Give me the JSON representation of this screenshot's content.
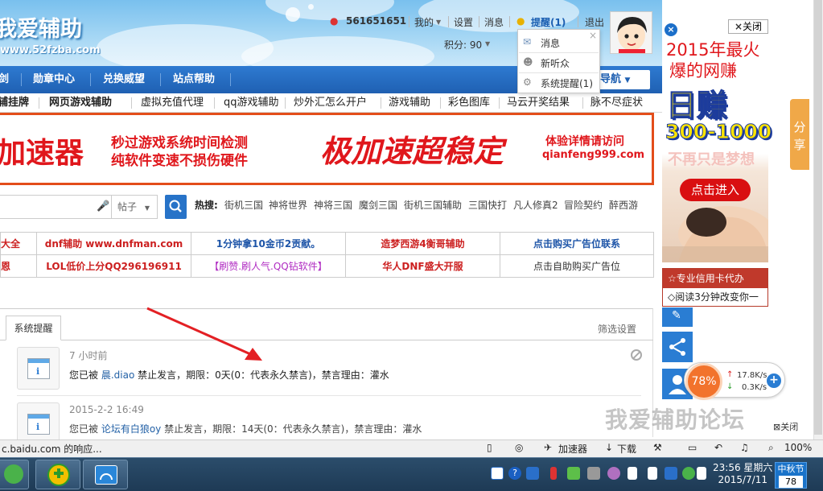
{
  "header": {
    "logo_text": "我爱辅助",
    "logo_url": "www.52fzba.com",
    "qq_number": "561651651",
    "my_label": "我的",
    "settings": "设置",
    "messages": "消息",
    "reminder": "提醒(1)",
    "logout": "退出",
    "points": "积分: 90"
  },
  "dropdown": {
    "items": [
      "消息",
      "新听众",
      "系统提醒(1)"
    ],
    "close": "×"
  },
  "nav": {
    "items": [
      "剑",
      "勋章中心",
      "兑换威望",
      "站点帮助"
    ],
    "right_button": "导航"
  },
  "quicklinks": [
    "辅挂牌",
    "网页游戏辅助",
    "虚拟充值代理",
    "qq游戏辅助",
    "炒外汇怎么开户",
    "游戏辅助",
    "彩色图库",
    "马云开奖结果",
    "脉不尽症状"
  ],
  "banner": {
    "left": "加速器",
    "mid1": "秒过游戏系统时间检测",
    "mid2": "纯软件变速不损伤硬件",
    "big": "极加速超稳定",
    "right1": "体验详情请访问",
    "right2": "qianfeng999.com"
  },
  "search": {
    "type": "帖子",
    "hot_label": "热搜:",
    "hot": [
      "街机三国",
      "神将世界",
      "神将三国",
      "魔剑三国",
      "街机三国辅助",
      "三国快打",
      "凡人修真2",
      "冒险契约",
      "醉西游"
    ]
  },
  "ads": {
    "row1": [
      "大全",
      "dnf辅助 www.dnfman.com",
      "1分钟拿10金币2贡献。",
      "造梦西游4衡哥辅助",
      "点击购买广告位联系"
    ],
    "row2": [
      "恩",
      "LOL低价上分QQ296196911",
      "【刷赞.刷人气.QQ钻软件】",
      "华人DNF盛大开服",
      "点击自助购买广告位"
    ]
  },
  "notices": {
    "tab": "系统提醒",
    "filter": "筛选设置",
    "items": [
      {
        "time": "7 小时前",
        "pre": "您已被 ",
        "user": "晨.diao",
        "post": " 禁止发言，期限：0天(0：代表永久禁言)，禁言理由：灌水"
      },
      {
        "time": "2015-2-2 16:49",
        "pre": "您已被 ",
        "user": "论坛有白狼oy",
        "post": " 禁止发言，期限：14天(0：代表永久禁言)，禁言理由：灌水"
      }
    ]
  },
  "right_ad": {
    "close": "关闭",
    "line1": "2015年最火",
    "line2": "爆的网赚",
    "line3": "日赚",
    "line4": "300-1000",
    "line5": "不再只是梦想",
    "button": "点击进入",
    "link1": "☆专业信用卡代办",
    "link2": "◇阅读3分钟改变你一"
  },
  "share": "分享",
  "speed": {
    "percent": "78%",
    "up": "17.8K/s",
    "down": "0.3K/s"
  },
  "watermark": {
    "text": "我爱辅助论坛",
    "close": "关闭"
  },
  "statusbar": {
    "left": "c.baidu.com 的响应...",
    "accelerator": "加速器",
    "download": "下载",
    "zoom": "100%"
  },
  "taskbar": {
    "time": "23:56 星期六",
    "date": "2015/7/11",
    "festival": "中秋节",
    "festival_days": "78"
  }
}
